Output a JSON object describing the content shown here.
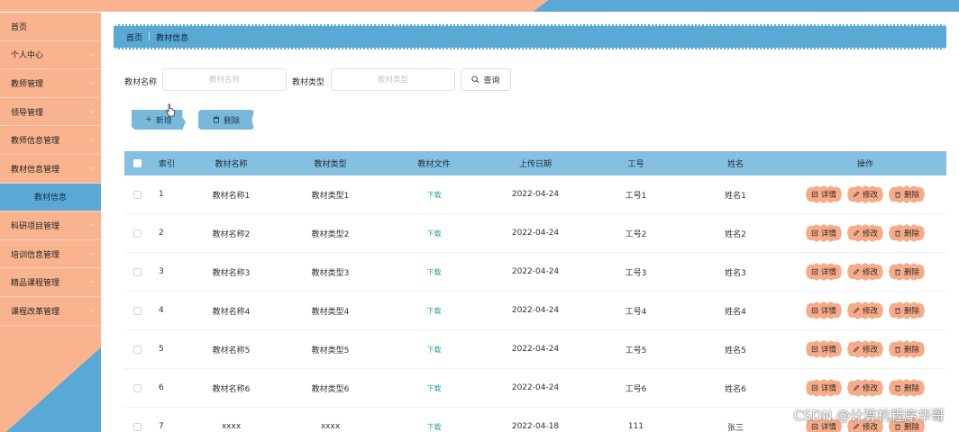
{
  "sidebar": {
    "items": [
      {
        "label": "首页",
        "chevron": false,
        "active": false
      },
      {
        "label": "个人中心",
        "chevron": true,
        "active": false
      },
      {
        "label": "教师管理",
        "chevron": true,
        "active": false
      },
      {
        "label": "领导管理",
        "chevron": true,
        "active": false
      },
      {
        "label": "教师信息管理",
        "chevron": true,
        "active": false
      },
      {
        "label": "教材信息管理",
        "chevron": true,
        "active": false
      },
      {
        "label": "教材信息",
        "chevron": false,
        "active": true
      },
      {
        "label": "科研项目管理",
        "chevron": true,
        "active": false
      },
      {
        "label": "培训信息管理",
        "chevron": true,
        "active": false
      },
      {
        "label": "精品课程管理",
        "chevron": true,
        "active": false
      },
      {
        "label": "课程改革管理",
        "chevron": true,
        "active": false
      }
    ]
  },
  "breadcrumb": {
    "home": "首页",
    "separator": "|",
    "current": "教材信息"
  },
  "search": {
    "name_label": "教材名称",
    "name_placeholder": "教材名称",
    "type_label": "教材类型",
    "type_placeholder": "教材类型",
    "query_label": "查询"
  },
  "actions": {
    "add_label": "新增",
    "delete_label": "删除"
  },
  "table": {
    "headers": [
      "索引",
      "教材名称",
      "教材类型",
      "教材文件",
      "上传日期",
      "工号",
      "姓名",
      "操作"
    ],
    "rows": [
      {
        "index": "1",
        "name": "教材名称1",
        "type": "教材类型1",
        "file": "下载",
        "date": "2022-04-24",
        "no": "工号1",
        "person": "姓名1"
      },
      {
        "index": "2",
        "name": "教材名称2",
        "type": "教材类型2",
        "file": "下载",
        "date": "2022-04-24",
        "no": "工号2",
        "person": "姓名2"
      },
      {
        "index": "3",
        "name": "教材名称3",
        "type": "教材类型3",
        "file": "下载",
        "date": "2022-04-24",
        "no": "工号3",
        "person": "姓名3"
      },
      {
        "index": "4",
        "name": "教材名称4",
        "type": "教材类型4",
        "file": "下载",
        "date": "2022-04-24",
        "no": "工号4",
        "person": "姓名4"
      },
      {
        "index": "5",
        "name": "教材名称5",
        "type": "教材类型5",
        "file": "下载",
        "date": "2022-04-24",
        "no": "工号5",
        "person": "姓名5"
      },
      {
        "index": "6",
        "name": "教材名称6",
        "type": "教材类型6",
        "file": "下载",
        "date": "2022-04-24",
        "no": "工号6",
        "person": "姓名6"
      },
      {
        "index": "7",
        "name": "xxxx",
        "type": "xxxx",
        "file": "下载",
        "date": "2022-04-18",
        "no": "111",
        "person": "张三"
      }
    ],
    "row_actions": {
      "detail": "详情",
      "edit": "修改",
      "delete": "删除"
    }
  },
  "watermark": "CSDN @计算机程序华哥",
  "colors": {
    "orange": "#f9b48f",
    "blue": "#5aa9d4",
    "header_blue": "#85c0e0",
    "button_orange": "#f7ab88",
    "link_teal": "#2aa39b"
  }
}
